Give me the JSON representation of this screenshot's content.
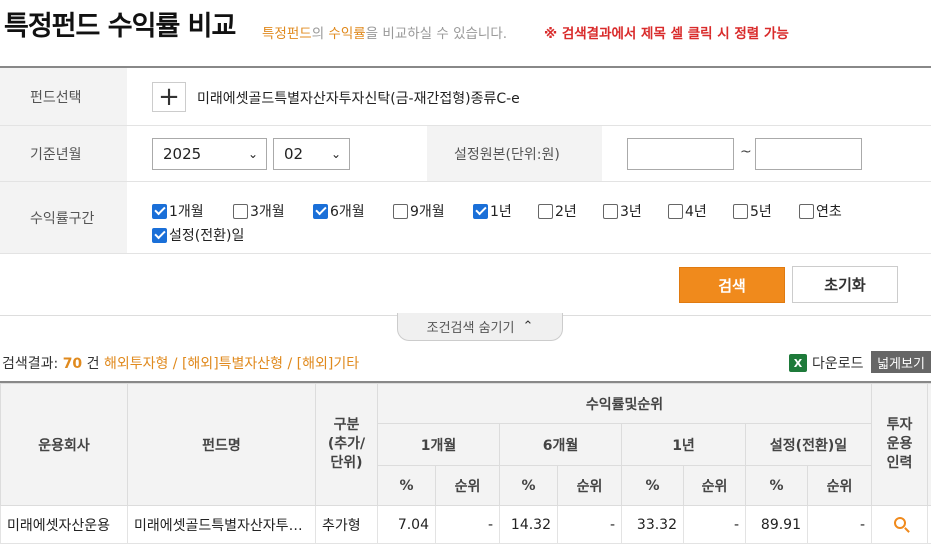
{
  "header": {
    "title": "특정펀드 수익률 비교",
    "subtitle_hl1": "특정펀드",
    "subtitle_mid": "의 ",
    "subtitle_hl2": "수익률",
    "subtitle_rest": "을 비교하실 수 있습니다.",
    "notice": "※ 검색결과에서 제목 셀 클릭 시 정렬 가능"
  },
  "form": {
    "fund_label": "펀드선택",
    "fund_add": "+",
    "fund_selected": "미래에셋골드특별자산자투자신탁(금-재간접형)종류C-e",
    "date_label": "기준년월",
    "year": "2025",
    "month": "02",
    "principal_label": "설정원본(단위:원)",
    "principal_from": "",
    "principal_to": "",
    "tilde": "~",
    "period_label": "수익률구간",
    "periods": [
      {
        "label": "1개월",
        "checked": true
      },
      {
        "label": "3개월",
        "checked": false
      },
      {
        "label": "6개월",
        "checked": true
      },
      {
        "label": "9개월",
        "checked": false
      },
      {
        "label": "1년",
        "checked": true
      },
      {
        "label": "2년",
        "checked": false
      },
      {
        "label": "3년",
        "checked": false
      },
      {
        "label": "4년",
        "checked": false
      },
      {
        "label": "5년",
        "checked": false
      },
      {
        "label": "연초",
        "checked": false
      },
      {
        "label": "설정(전환)일",
        "checked": true
      }
    ],
    "search_btn": "검색",
    "reset_btn": "초기화",
    "toggle": "조건검색 숨기기"
  },
  "result": {
    "prefix": "검색결과: ",
    "count": "70",
    "unit": " 건 ",
    "categories": "해외투자형 / [해외]특별자산형 / [해외]기타",
    "download": "다운로드",
    "wide_view": "넓게보기"
  },
  "table": {
    "h_company": "운용회사",
    "h_fund": "펀드명",
    "h_type": "구분\n(추가/\n단위)",
    "h_returns": "수익률및순위",
    "h_manager": "투자\n운용\n인력",
    "periods": [
      "1개월",
      "6개월",
      "1년",
      "설정(전환)일"
    ],
    "pct": "%",
    "rank": "순위",
    "rows": [
      {
        "company": "미래에셋자산운용",
        "fund": "미래에셋골드특별자산자투자신탁",
        "type": "추가형",
        "m1": "7.04",
        "m1r": "-",
        "m6": "14.32",
        "m6r": "-",
        "y1": "33.32",
        "y1r": "-",
        "inc": "89.91",
        "incr": "-"
      }
    ]
  }
}
